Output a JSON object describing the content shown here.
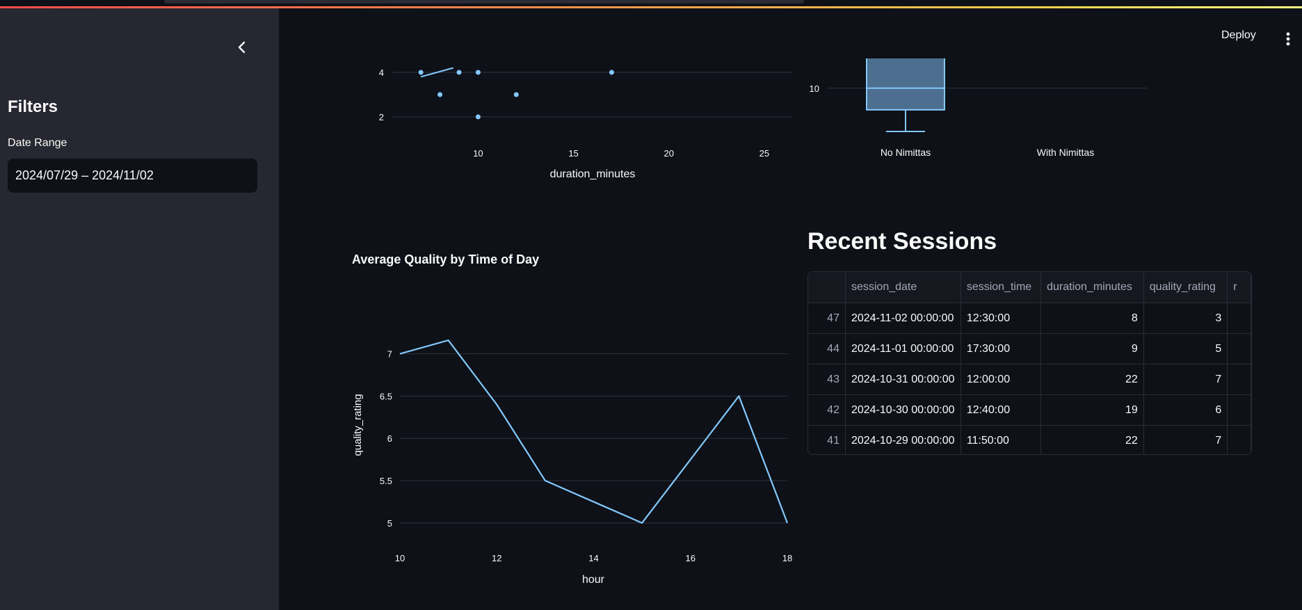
{
  "app": {
    "deploy_label": "Deploy"
  },
  "sidebar": {
    "title": "Filters",
    "date_range_label": "Date Range",
    "date_range_value": "2024/07/29 – 2024/11/02"
  },
  "scatter_chart": {
    "xlabel": "duration_minutes",
    "x_ticks": [
      "10",
      "15",
      "20",
      "25"
    ],
    "y_ticks": [
      "2",
      "4"
    ]
  },
  "box_chart": {
    "y_ticks": [
      "10"
    ],
    "categories": [
      "No Nimittas",
      "With Nimittas"
    ]
  },
  "line_chart": {
    "title": "Average Quality by Time of Day",
    "xlabel": "hour",
    "ylabel": "quality_rating",
    "x_ticks": [
      "10",
      "12",
      "14",
      "16",
      "18"
    ],
    "y_ticks": [
      "5",
      "5.5",
      "6",
      "6.5",
      "7"
    ]
  },
  "recent_sessions": {
    "title": "Recent Sessions",
    "columns": [
      "",
      "session_date",
      "session_time",
      "duration_minutes",
      "quality_rating",
      "r"
    ],
    "rows": [
      {
        "index": "47",
        "session_date": "2024-11-02 00:00:00",
        "session_time": "12:30:00",
        "duration_minutes": "8",
        "quality_rating": "3"
      },
      {
        "index": "44",
        "session_date": "2024-11-01 00:00:00",
        "session_time": "17:30:00",
        "duration_minutes": "9",
        "quality_rating": "5"
      },
      {
        "index": "43",
        "session_date": "2024-10-31 00:00:00",
        "session_time": "12:00:00",
        "duration_minutes": "22",
        "quality_rating": "7"
      },
      {
        "index": "42",
        "session_date": "2024-10-30 00:00:00",
        "session_time": "12:40:00",
        "duration_minutes": "19",
        "quality_rating": "6"
      },
      {
        "index": "41",
        "session_date": "2024-10-29 00:00:00",
        "session_time": "11:50:00",
        "duration_minutes": "22",
        "quality_rating": "7"
      }
    ]
  },
  "chart_data": [
    {
      "type": "scatter",
      "xlabel": "duration_minutes",
      "ylabel": "",
      "xlim": [
        5.5,
        26.5
      ],
      "ylim": [
        1.5,
        5
      ],
      "points": [
        {
          "x": 7,
          "y": 4
        },
        {
          "x": 9,
          "y": 4
        },
        {
          "x": 10,
          "y": 4
        },
        {
          "x": 17,
          "y": 4
        },
        {
          "x": 8,
          "y": 3
        },
        {
          "x": 12,
          "y": 3
        },
        {
          "x": 10,
          "y": 2
        }
      ],
      "trendline": [
        {
          "x": 7,
          "y": 3.8
        },
        {
          "x": 8.7,
          "y": 4.2
        }
      ]
    },
    {
      "type": "box",
      "categories": [
        "No Nimittas",
        "With Nimittas"
      ],
      "boxes": [
        {
          "category": "No Nimittas",
          "min": 8.4,
          "q1": 9.2,
          "median": 10,
          "q3": 12
        }
      ],
      "ylim": [
        7.5,
        12
      ]
    },
    {
      "type": "line",
      "title": "Average Quality by Time of Day",
      "xlabel": "hour",
      "ylabel": "quality_rating",
      "xlim": [
        10,
        18
      ],
      "ylim": [
        4.9,
        7.4
      ],
      "x": [
        10,
        11,
        12,
        13,
        15,
        17,
        18
      ],
      "y": [
        7.0,
        7.16,
        6.4,
        5.5,
        5.0,
        6.5,
        5.0
      ]
    }
  ]
}
